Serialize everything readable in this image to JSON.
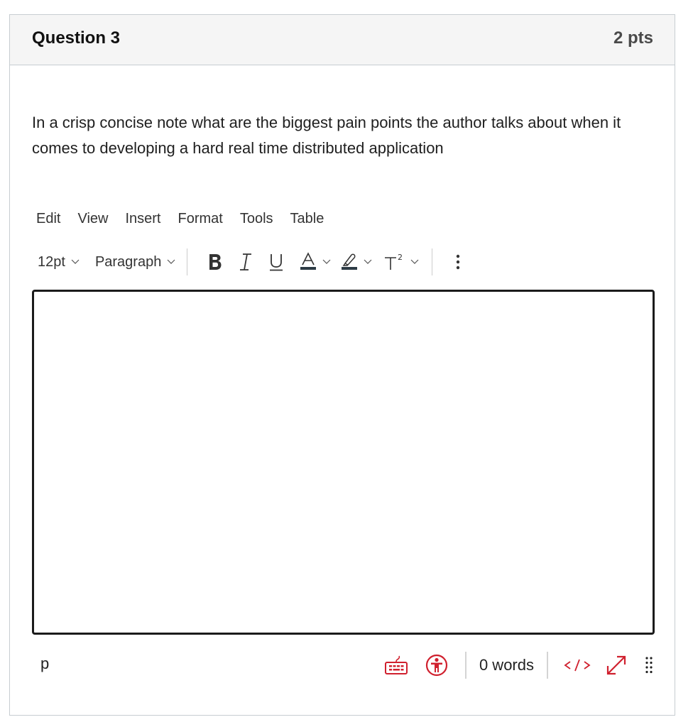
{
  "question": {
    "title": "Question 3",
    "points": "2 pts",
    "text": "In a crisp concise note what are the biggest pain points the author talks about when it comes to developing a hard real time distributed application"
  },
  "editor": {
    "menubar": [
      "Edit",
      "View",
      "Insert",
      "Format",
      "Tools",
      "Table"
    ],
    "toolbar": {
      "font_size": "12pt",
      "block_format": "Paragraph",
      "buttons": [
        "bold-icon",
        "italic-icon",
        "underline-icon",
        "text-color-icon",
        "highlight-color-icon",
        "superscript-icon",
        "more-options-icon"
      ]
    },
    "content": "",
    "status": {
      "path": "p",
      "word_count": "0 words",
      "html_toggle": "</>"
    },
    "colors": {
      "accent_red": "#d0202e",
      "border_dark": "#1b1b1b"
    }
  }
}
